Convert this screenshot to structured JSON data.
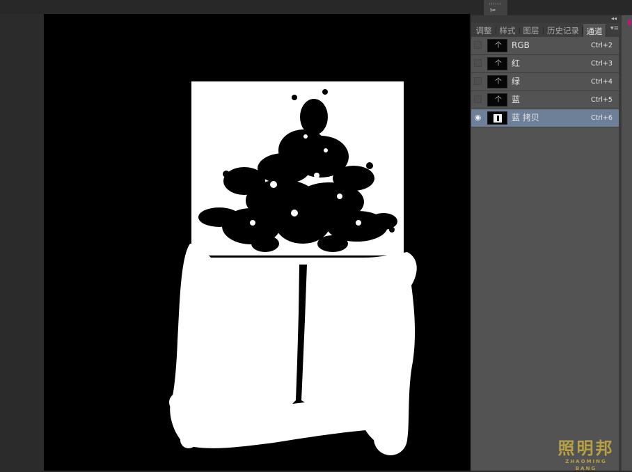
{
  "panel": {
    "tabs": [
      {
        "label": "调整",
        "active": false
      },
      {
        "label": "样式",
        "active": false
      },
      {
        "label": "图层",
        "active": false
      },
      {
        "label": "历史记录",
        "active": false
      },
      {
        "label": "通道",
        "active": true
      }
    ],
    "collapse_icon": "double-chevron-left-icon",
    "close_icon": "close-icon",
    "menu_icon": "panel-menu-icon",
    "channels": [
      {
        "name": "RGB",
        "shortcut": "Ctrl+2",
        "visible": false,
        "selected": false
      },
      {
        "name": "红",
        "shortcut": "Ctrl+3",
        "visible": false,
        "selected": false
      },
      {
        "name": "绿",
        "shortcut": "Ctrl+4",
        "visible": false,
        "selected": false
      },
      {
        "name": "蓝",
        "shortcut": "Ctrl+5",
        "visible": false,
        "selected": false
      },
      {
        "name": "蓝 拷贝",
        "shortcut": "Ctrl+6",
        "visible": true,
        "selected": true
      }
    ]
  },
  "watermark": {
    "chinese": "照明邦",
    "pinyin": "ZHAOMING BANG"
  },
  "colors": {
    "panel_bg": "#535353",
    "selected_row": "#6e7f98",
    "canvas_bg": "#000000",
    "watermark": "#b7a046"
  }
}
